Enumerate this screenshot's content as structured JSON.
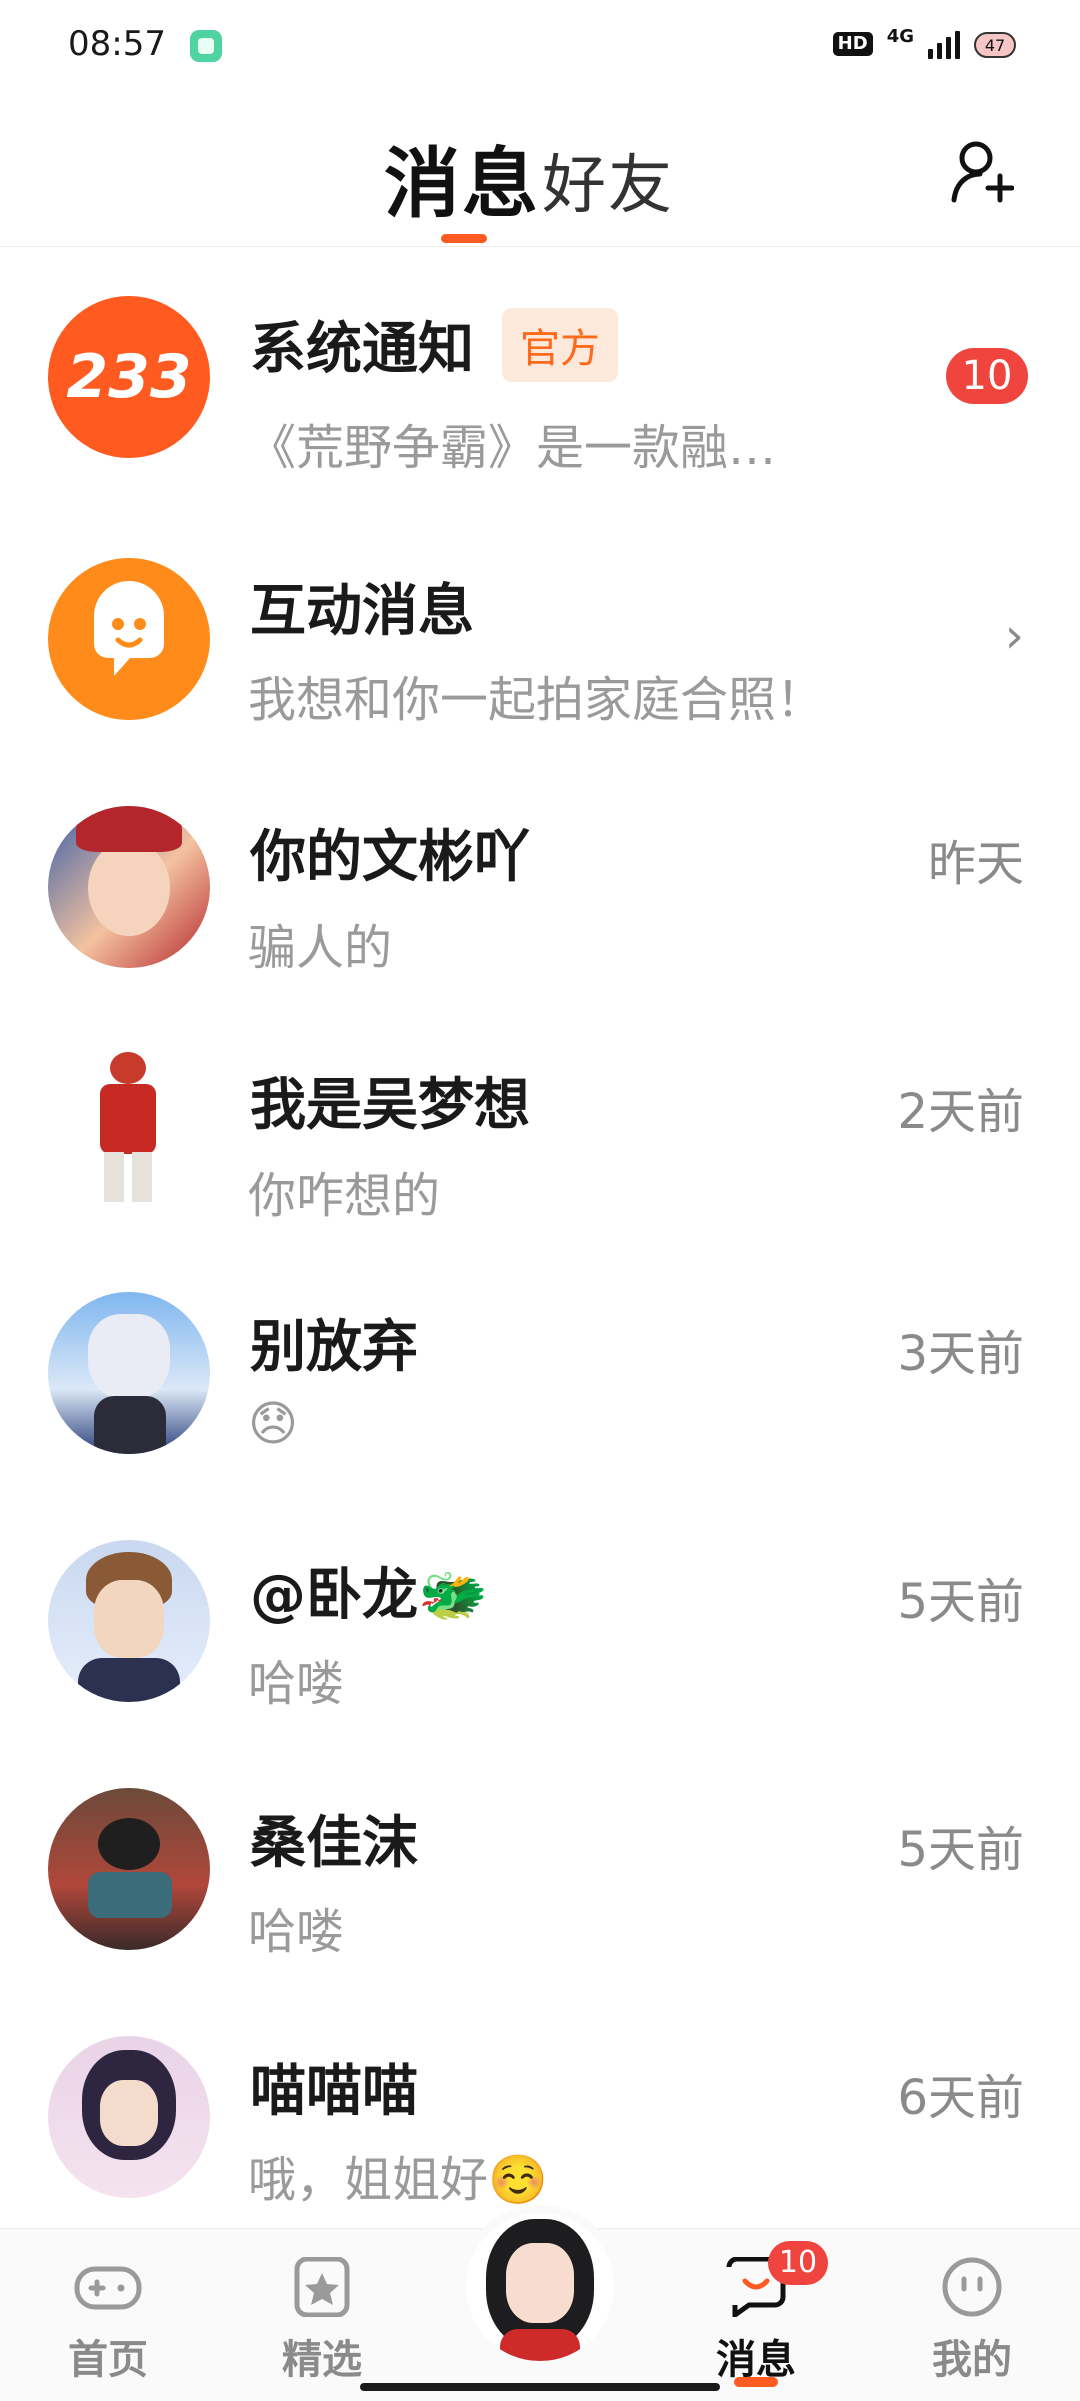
{
  "status_bar": {
    "time": "08:57",
    "hd_label": "HD",
    "network": "4G",
    "battery": "47"
  },
  "header": {
    "tab_messages": "消息",
    "tab_friends": "好友",
    "add_friend_icon": "add-person-icon"
  },
  "conversations": [
    {
      "name": "系统通知",
      "tag": "官方",
      "preview": "《荒野争霸》是一款融…",
      "unread": "10",
      "avatar_text": "233",
      "accent": "#ff5a1f"
    },
    {
      "name": "互动消息",
      "preview": "我想和你一起拍家庭合照！",
      "accent": "#ff8c1a"
    },
    {
      "name": "你的文彬吖",
      "preview": "骗人的",
      "time": "昨天"
    },
    {
      "name": "我是吴梦想",
      "preview": "你咋想的",
      "time": "2天前"
    },
    {
      "name": "别放弃",
      "preview": "😞",
      "time": "3天前"
    },
    {
      "name": "@卧龙🐲",
      "preview": "哈喽",
      "time": "5天前"
    },
    {
      "name": "桑佳沫",
      "preview": "哈喽",
      "time": "5天前"
    },
    {
      "name": "喵喵喵",
      "preview": "哦，姐姐好☺️",
      "time": "6天前"
    }
  ],
  "bottom_nav": {
    "home": "首页",
    "featured": "精选",
    "messages": "消息",
    "messages_badge": "10",
    "me": "我的"
  },
  "colors": {
    "accent": "#ff5a1f",
    "badge_red": "#f0443f"
  }
}
